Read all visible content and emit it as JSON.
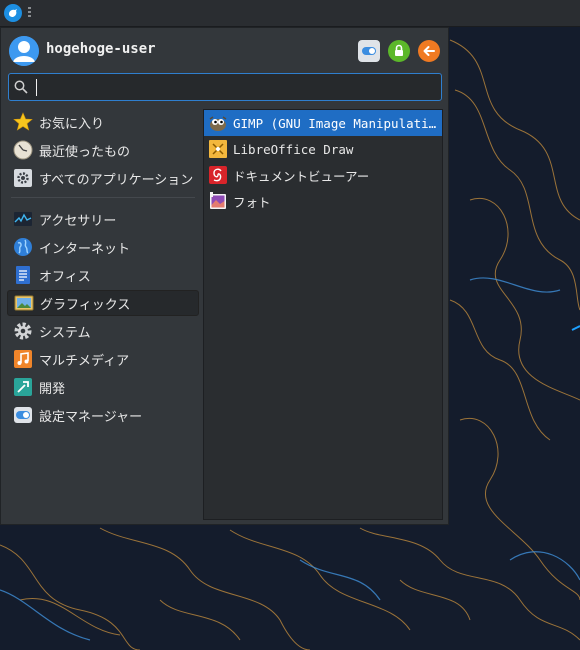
{
  "user": {
    "name": "hogehoge-user"
  },
  "search": {
    "value": "",
    "placeholder": ""
  },
  "categories": [
    {
      "label": "お気に入り",
      "icon": "star-icon"
    },
    {
      "label": "最近使ったもの",
      "icon": "clock-icon"
    },
    {
      "label": "すべてのアプリケーション",
      "icon": "gear-icon"
    },
    {
      "label": "アクセサリー",
      "icon": "accessories-icon"
    },
    {
      "label": "インターネット",
      "icon": "globe-icon"
    },
    {
      "label": "オフィス",
      "icon": "document-icon"
    },
    {
      "label": "グラフィックス",
      "icon": "picture-icon"
    },
    {
      "label": "システム",
      "icon": "gear-icon"
    },
    {
      "label": "マルチメディア",
      "icon": "music-icon"
    },
    {
      "label": "開発",
      "icon": "hammer-icon"
    },
    {
      "label": "設定マネージャー",
      "icon": "toggle-icon"
    }
  ],
  "active_category": "グラフィックス",
  "apps": [
    {
      "label": "GIMP (GNU Image Manipulation Program)",
      "icon": "gimp-icon"
    },
    {
      "label": "LibreOffice Draw",
      "icon": "draw-icon"
    },
    {
      "label": "ドキュメントビューアー",
      "icon": "pdf-icon"
    },
    {
      "label": "フォト",
      "icon": "photos-icon"
    }
  ],
  "colors": {
    "accent": "#1f6dc4",
    "lock": "#5cb82a",
    "logout": "#f07a22"
  }
}
